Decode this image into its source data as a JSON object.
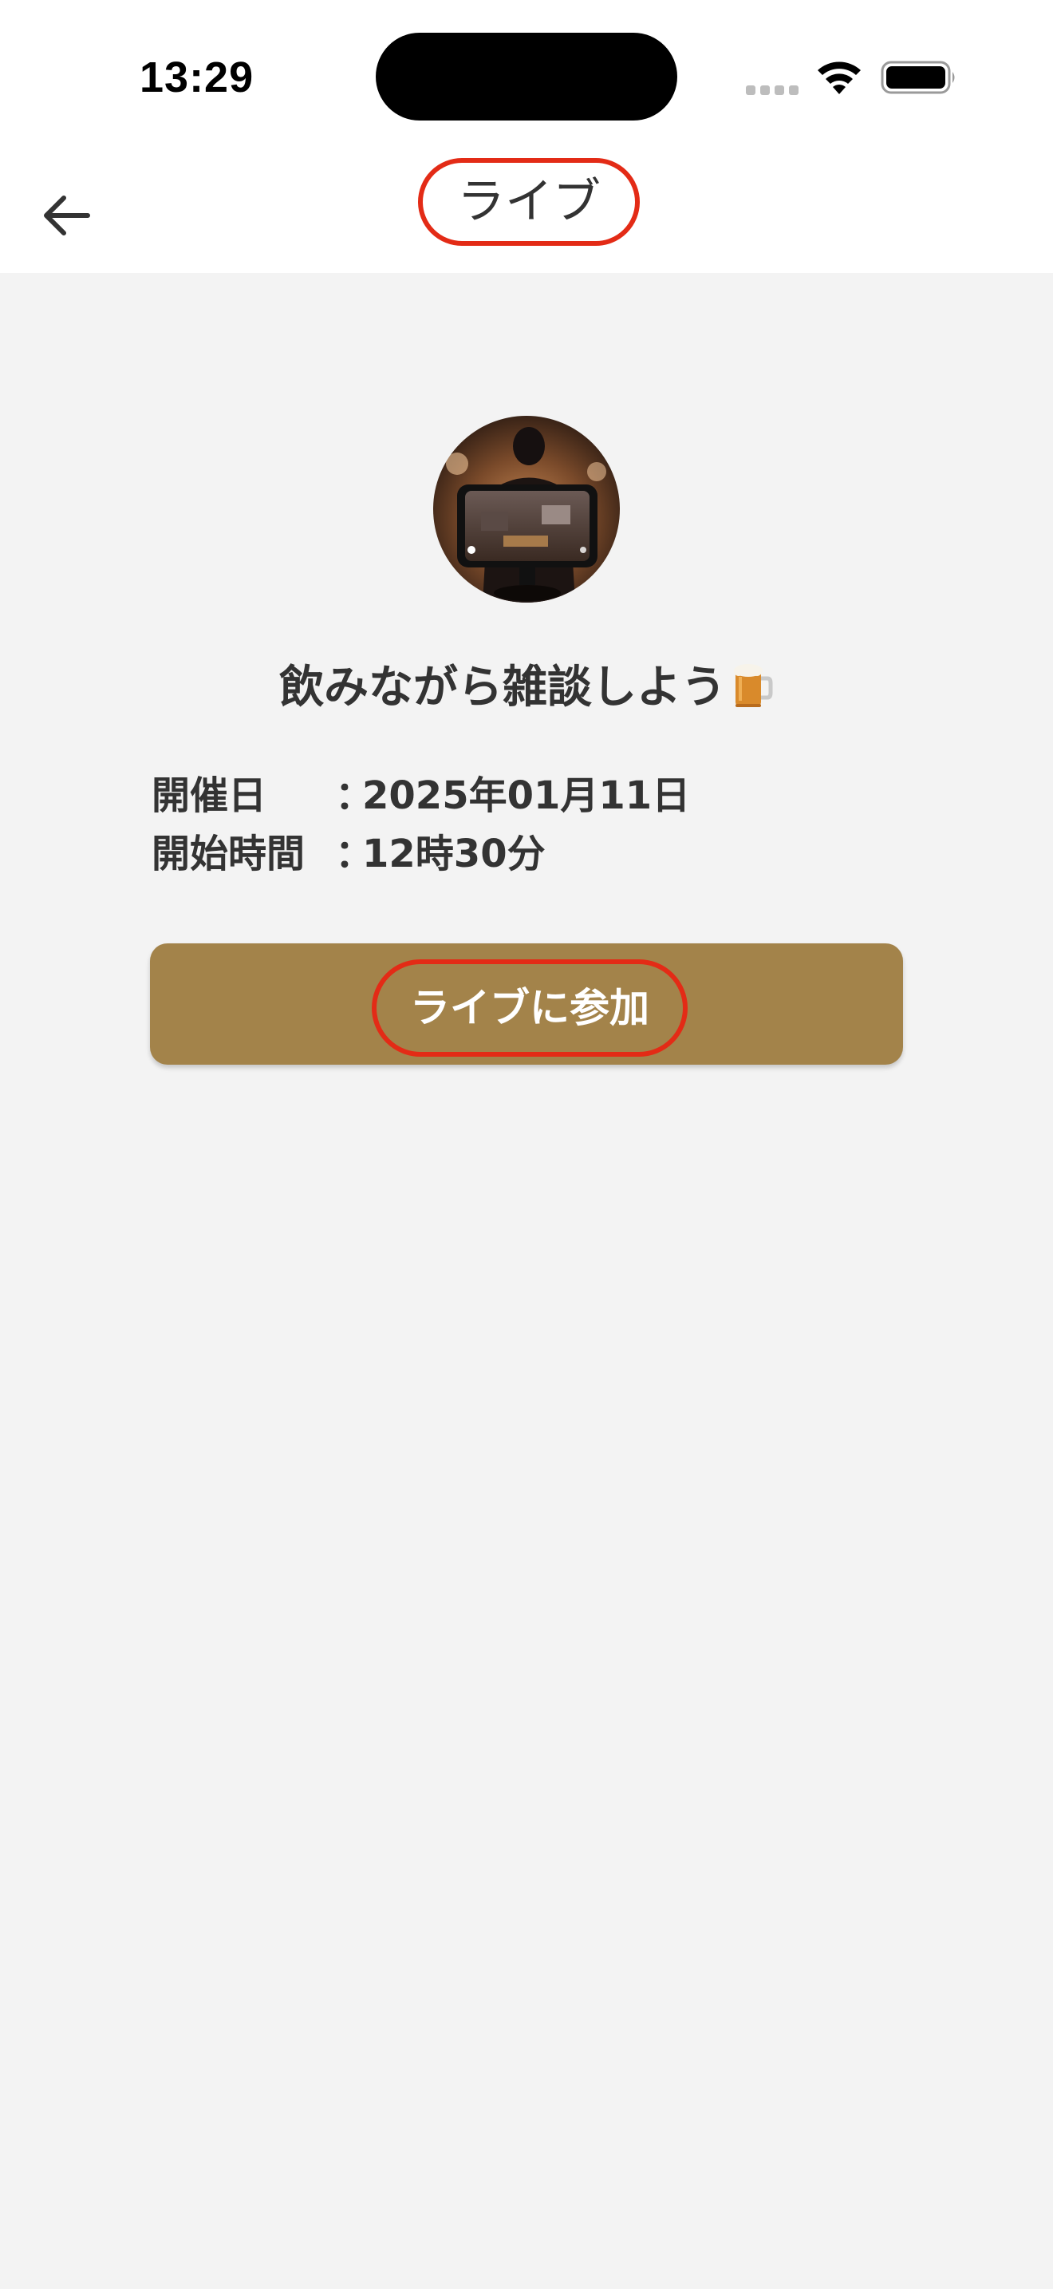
{
  "status_bar": {
    "time": "13:29",
    "icons": [
      "signal-icon",
      "wifi-icon",
      "battery-icon"
    ]
  },
  "nav": {
    "back_icon": "arrow-left-icon",
    "title": "ライブ",
    "annotation_color": "#e32b16"
  },
  "live": {
    "thumbnail_icon": "live-stream-photo",
    "title": "飲みながら雑談しよう",
    "title_emoji": "beer-mug-icon",
    "date_label": "開催日",
    "date_separator": "：",
    "date_value": "2025年01月11日",
    "time_label": "開始時間",
    "time_separator": "：",
    "time_value": "12時30分",
    "join_button_label": "ライブに参加"
  },
  "colors": {
    "background": "#f3f3f3",
    "header": "#ffffff",
    "text": "#333333",
    "button": "#a3834a",
    "button_text": "#ffffff",
    "annotation": "#e32b16"
  }
}
